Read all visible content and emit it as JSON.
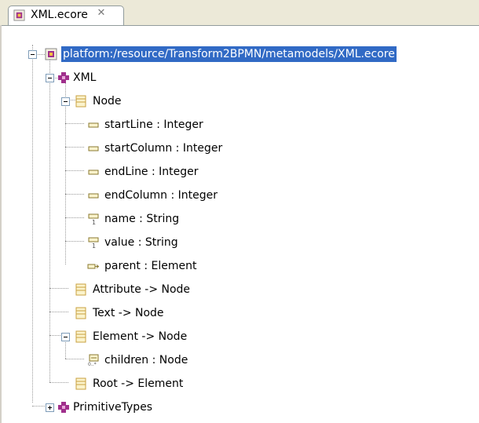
{
  "editor_tab": {
    "title": "XML.ecore",
    "close_icon": "close-icon"
  },
  "tree": {
    "resource": {
      "label": "platform:/resource/Transform2BPMN/metamodels/XML.ecore",
      "icon": "resource-icon"
    },
    "package_xml": {
      "label": "XML",
      "icon": "package-icon"
    },
    "class_node": {
      "label": "Node",
      "icon": "class-icon"
    },
    "attr_start_line": {
      "label": "startLine : Integer",
      "icon": "attribute-icon"
    },
    "attr_start_column": {
      "label": "startColumn : Integer",
      "icon": "attribute-icon"
    },
    "attr_end_line": {
      "label": "endLine : Integer",
      "icon": "attribute-icon"
    },
    "attr_end_column": {
      "label": "endColumn : Integer",
      "icon": "attribute-icon"
    },
    "attr_name": {
      "label": "name : String",
      "icon": "required-attribute-icon"
    },
    "attr_value": {
      "label": "value : String",
      "icon": "required-attribute-icon"
    },
    "ref_parent": {
      "label": "parent : Element",
      "icon": "reference-icon"
    },
    "class_attribute": {
      "label": "Attribute -> Node",
      "icon": "class-icon"
    },
    "class_text": {
      "label": "Text -> Node",
      "icon": "class-icon"
    },
    "class_element": {
      "label": "Element -> Node",
      "icon": "class-icon"
    },
    "ref_children": {
      "label": "children : Node",
      "icon": "containment-reference-icon"
    },
    "class_root": {
      "label": "Root -> Element",
      "icon": "class-icon"
    },
    "package_primitive_types": {
      "label": "PrimitiveTypes",
      "icon": "package-icon"
    }
  },
  "colors": {
    "selection": "#316ac5",
    "tab_background": "#ece9d8",
    "package": "#a0308c",
    "class_icon": "#c8a040"
  }
}
